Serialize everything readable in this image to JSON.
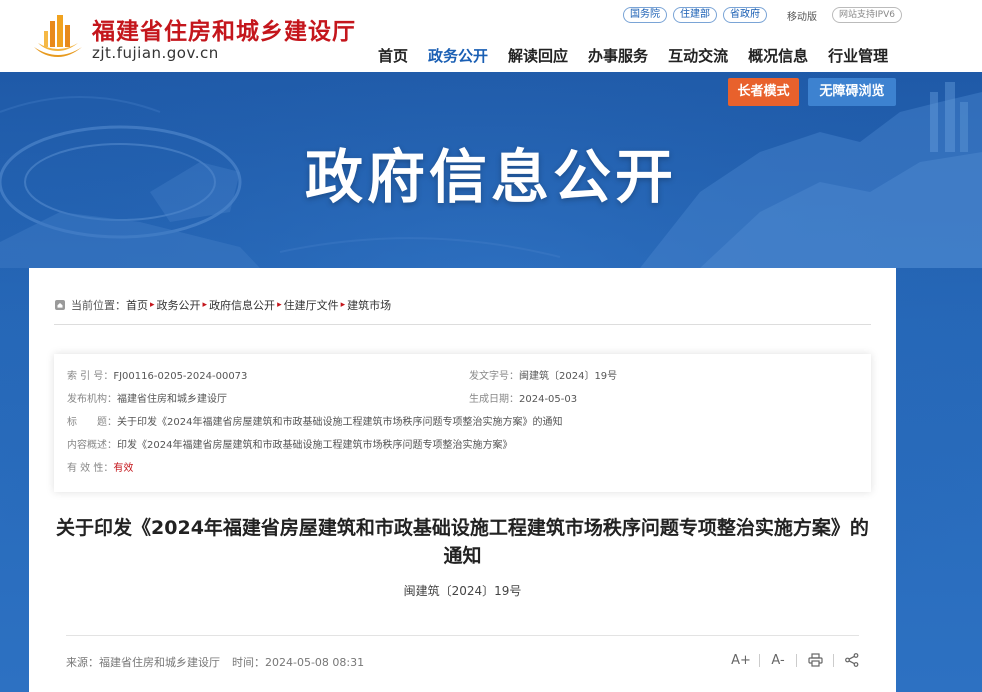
{
  "site": {
    "title": "福建省住房和城乡建设厅",
    "domain": "zjt.fujian.gov.cn",
    "brand_red": "#c4161c",
    "brand_blue": "#1a5fb4"
  },
  "quicklinks": [
    "国务院",
    "住建部",
    "省政府"
  ],
  "mobile_label": "移动版",
  "ipv6_label": "网站支持IPV6",
  "nav": {
    "items": [
      "首页",
      "政务公开",
      "解读回应",
      "办事服务",
      "互动交流",
      "概况信息",
      "行业管理"
    ],
    "active": "政务公开"
  },
  "banner": {
    "title": "政府信息公开",
    "elder_mode": "长者模式",
    "accessible": "无障碍浏览"
  },
  "breadcrumb": {
    "prefix": "当前位置：",
    "items": [
      "首页",
      "政务公开",
      "政府信息公开",
      "住建厅文件",
      "建筑市场"
    ]
  },
  "info": {
    "index_label": "索 引 号：",
    "index_value": "FJ00116-0205-2024-00073",
    "docno_label": "发文字号：",
    "docno_value": "闽建筑〔2024〕19号",
    "org_label": "发布机构：",
    "org_value": "福建省住房和城乡建设厅",
    "date_label": "生成日期：",
    "date_value": "2024-05-03",
    "title_label": "标　　题：",
    "title_value": "关于印发《2024年福建省房屋建筑和市政基础设施工程建筑市场秩序问题专项整治实施方案》的通知",
    "summary_label": "内容概述：",
    "summary_value": "印发《2024年福建省房屋建筑和市政基础设施工程建筑市场秩序问题专项整治实施方案》",
    "validity_label": "有 效 性：",
    "validity_value": "有效"
  },
  "article": {
    "title": "关于印发《2024年福建省房屋建筑和市政基础设施工程建筑市场秩序问题专项整治实施方案》的通知",
    "doc_no": "闽建筑〔2024〕19号",
    "source": "来源：福建省住房和城乡建设厅",
    "time": "时间：2024-05-08 08:31"
  },
  "tools": {
    "font_up": "A+",
    "font_down": "A-"
  }
}
